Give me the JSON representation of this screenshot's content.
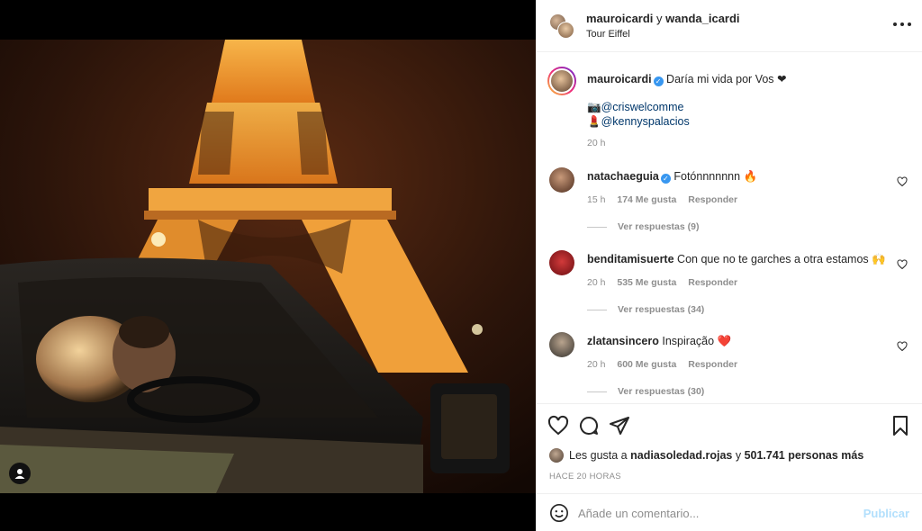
{
  "header": {
    "user1": "mauroicardi",
    "joiner": "y",
    "user2": "wanda_icardi",
    "location": "Tour Eiffel",
    "more_icon": "more-horizontal-icon"
  },
  "caption": {
    "username": "mauroicardi",
    "text": "Daría mi vida por Vos ❤",
    "credit1_emoji": "📷",
    "credit1": "@criswelcomme",
    "credit2_emoji": "💄",
    "credit2": "@kennyspalacios",
    "time": "20 h"
  },
  "comments": [
    {
      "username": "natachaeguia",
      "verified": true,
      "text": "Fotónnnnnnn 🔥",
      "time": "15 h",
      "likes": "174 Me gusta",
      "reply": "Responder",
      "replies": "Ver respuestas (9)"
    },
    {
      "username": "benditamisuerte",
      "verified": false,
      "text": "Con que no te garches a otra estamos 🙌",
      "time": "20 h",
      "likes": "535 Me gusta",
      "reply": "Responder",
      "replies": "Ver respuestas (34)"
    },
    {
      "username": "zlatansincero",
      "verified": false,
      "text": "Inspiração ❤️",
      "time": "20 h",
      "likes": "600 Me gusta",
      "reply": "Responder",
      "replies": "Ver respuestas (30)"
    }
  ],
  "actions": {
    "likes_prefix": "Les gusta a",
    "liker": "nadiasoledad.rojas",
    "likes_join": "y",
    "likes_count": "501.741 personas más",
    "time_ago": "HACE 20 HORAS"
  },
  "composer": {
    "placeholder": "Añade un comentario...",
    "post_label": "Publicar"
  },
  "colors": {
    "link": "#00376b",
    "verified": "#3897f0",
    "post_disabled": "#b2dffc",
    "muted": "#8e8e8e"
  }
}
